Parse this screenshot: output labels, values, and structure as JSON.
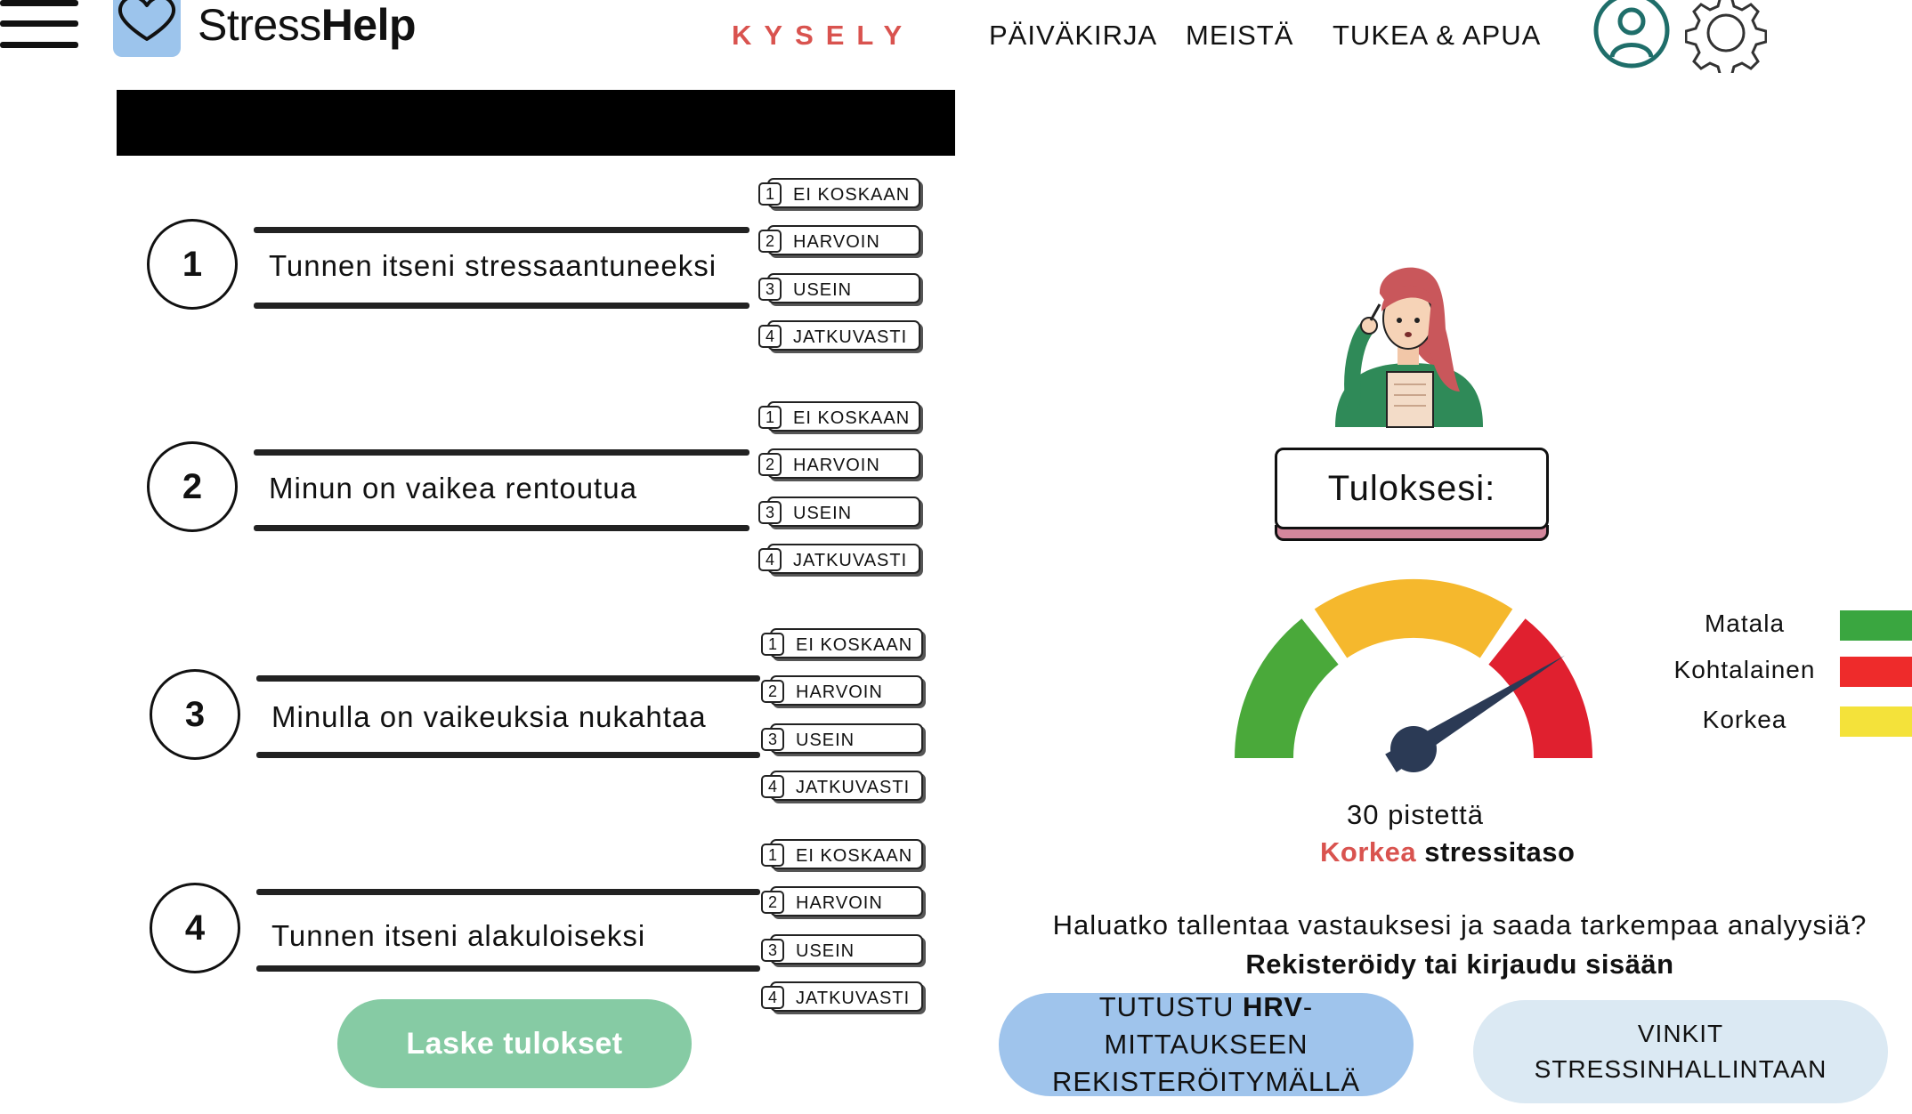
{
  "header": {
    "brand_part1": "Stress",
    "brand_part2": "Help",
    "nav": {
      "kysely": "KYSELY",
      "paivakirja": "PÄIVÄKIRJA",
      "meista": "MEISTÄ",
      "tukea": "TUKEA & APUA"
    },
    "icons": [
      "menu-icon",
      "heart-icon",
      "user-icon",
      "gear-icon"
    ]
  },
  "questions": [
    {
      "number": "1",
      "text": "Tunnen itseni stressaantuneeksi"
    },
    {
      "number": "2",
      "text": "Minun on vaikea rentoutua"
    },
    {
      "number": "3",
      "text": "Minulla on vaikeuksia nukahtaa"
    },
    {
      "number": "4",
      "text": "Tunnen itseni alakuloiseksi"
    }
  ],
  "options": [
    {
      "number": "1",
      "label": "EI KOSKAAN"
    },
    {
      "number": "2",
      "label": "HARVOIN"
    },
    {
      "number": "3",
      "label": "USEIN"
    },
    {
      "number": "4",
      "label": "JATKUVASTI"
    }
  ],
  "calculate_button": "Laske tulokset",
  "result": {
    "title": "Tuloksesi:",
    "points": "30 pistettä",
    "level_word": "Korkea",
    "level_suffix": " stressitaso",
    "gauge_value_fraction": 0.85
  },
  "legend": [
    {
      "label": "Matala",
      "color": "#3aa640"
    },
    {
      "label": "Kohtalainen",
      "color": "#ee2b2b"
    },
    {
      "label": "Korkea",
      "color": "#f4e23a"
    }
  ],
  "colors": {
    "accent_red": "#d9534f",
    "gauge_green": "#4aa93a",
    "gauge_yellow": "#f5b82d",
    "gauge_red": "#e0202f",
    "needle": "#2b3a55",
    "calc_button": "#86cba4",
    "hrv_button": "#9fc4ec",
    "tips_button": "#dbe9f3",
    "profile_icon": "#1f6e6a"
  },
  "cta": {
    "question": "Haluatko tallentaa vastauksesi ja saada tarkempaa analyysiä?",
    "register": "Rekisteröidy tai kirjaudu sisään",
    "hrv_line1_pre": "TUTUSTU ",
    "hrv_line1_bold": "HRV",
    "hrv_line1_post": "-MITTAUKSEEN",
    "hrv_line2": "REKISTERÖITYMÄLLÄ",
    "tips_line1": "VINKIT",
    "tips_line2": "STRESSINHALLINTAAN"
  }
}
